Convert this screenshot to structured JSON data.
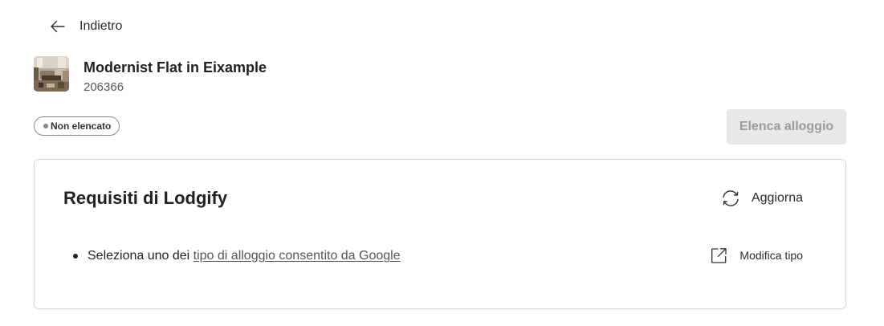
{
  "nav": {
    "back_label": "Indietro"
  },
  "property": {
    "name": "Modernist Flat in Eixample",
    "id": "206366",
    "status": "Non elencato",
    "list_button": "Elenca alloggio"
  },
  "requirements": {
    "title": "Requisiti di Lodgify",
    "refresh_label": "Aggiorna",
    "items": [
      {
        "text": "Seleziona uno dei ",
        "link": "tipo di alloggio consentito da Google",
        "action_label": "Modifica tipo"
      }
    ]
  },
  "icons": {
    "back": "arrow-left-icon",
    "refresh": "refresh-icon",
    "edit": "external-link-icon",
    "thumbnail": "property-photo"
  },
  "colors": {
    "disabled_button_bg": "#e8e8e8",
    "disabled_button_text": "#9b9b9b",
    "badge_border": "#8a8a8a",
    "card_border": "#d8d8d8"
  }
}
